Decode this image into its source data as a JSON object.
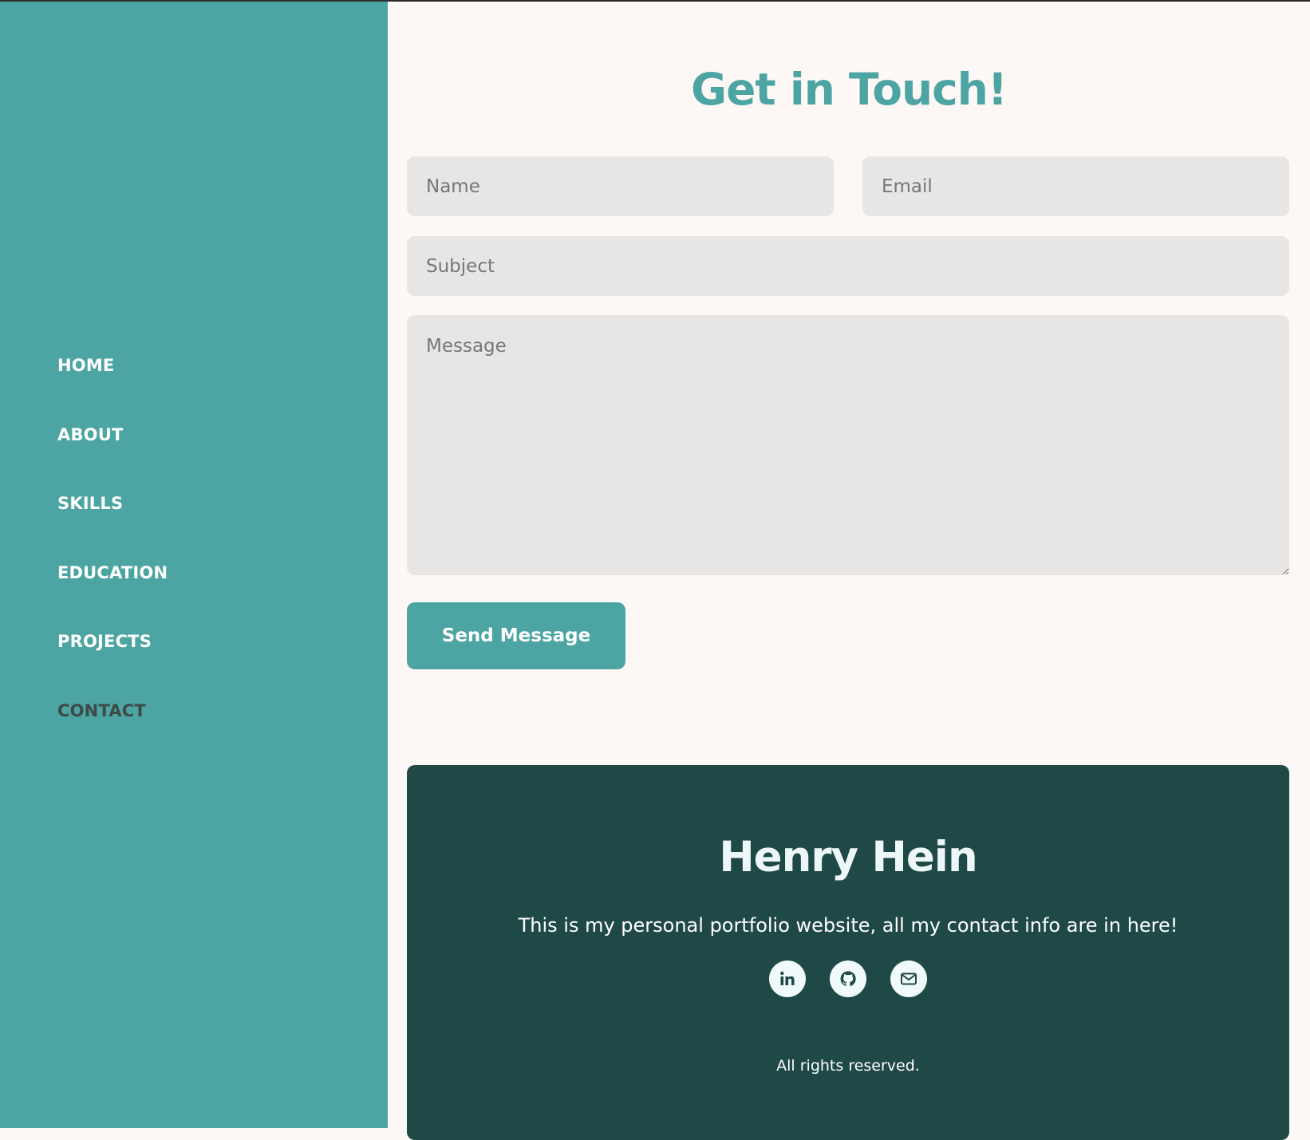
{
  "nav": {
    "items": [
      {
        "label": "HOME"
      },
      {
        "label": "ABOUT"
      },
      {
        "label": "SKILLS"
      },
      {
        "label": "EDUCATION"
      },
      {
        "label": "PROJECTS"
      },
      {
        "label": "CONTACT"
      }
    ],
    "active": "CONTACT"
  },
  "contact": {
    "heading": "Get in Touch!",
    "name_placeholder": "Name",
    "email_placeholder": "Email",
    "subject_placeholder": "Subject",
    "message_placeholder": "Message",
    "send_label": "Send Message"
  },
  "footer": {
    "name": "Henry Hein",
    "tagline": "This is my personal portfolio website, all my contact info are in here!",
    "socials": [
      {
        "icon": "linkedin-icon"
      },
      {
        "icon": "github-icon"
      },
      {
        "icon": "mail-icon"
      }
    ],
    "copyright": "All rights reserved."
  },
  "colors": {
    "sidebar": "#4ca5a2",
    "accent": "#4ca5a2",
    "footer_bg": "#1f4947",
    "page_bg": "#fdf8f6",
    "field_bg": "#e8e6e4",
    "nav_active": "#3d4a48"
  }
}
